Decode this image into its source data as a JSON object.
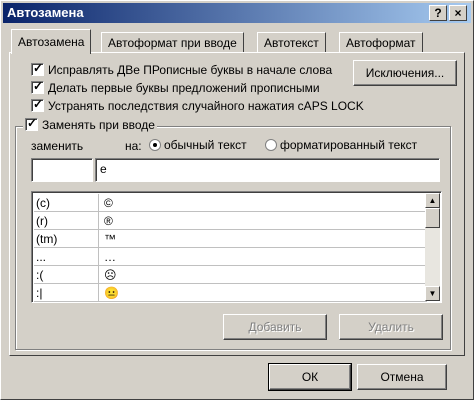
{
  "window": {
    "title": "Автозамена",
    "help_glyph": "?",
    "close_glyph": "×"
  },
  "tabs": [
    {
      "label": "Автозамена",
      "active": true
    },
    {
      "label": "Автоформат при вводе",
      "active": false
    },
    {
      "label": "Автотекст",
      "active": false
    },
    {
      "label": "Автоформат",
      "active": false
    }
  ],
  "options": [
    {
      "label": "Исправлять ДВе ПРописные буквы в начале слова",
      "checked": true
    },
    {
      "label": "Делать первые буквы предложений прописными",
      "checked": true
    },
    {
      "label": "Устранять последствия случайного нажатия cAPS LOCK",
      "checked": true
    }
  ],
  "exceptions_button": "Исключения...",
  "replace_group": {
    "label": "Заменять при вводе",
    "checked": true
  },
  "replace_label": "заменить",
  "with_label": "на:",
  "radio_plain": {
    "label": "обычный текст",
    "selected": true
  },
  "radio_formatted": {
    "label": "форматированный текст",
    "selected": false
  },
  "replace_input_value": "",
  "with_input_value": "е",
  "list": [
    {
      "from": "(c)",
      "to": "©"
    },
    {
      "from": "(r)",
      "to": "®"
    },
    {
      "from": "(tm)",
      "to": "™"
    },
    {
      "from": "...",
      "to": "…"
    },
    {
      "from": ":(",
      "to": "☹"
    },
    {
      "from": ":|",
      "to": "😐"
    }
  ],
  "scroll_up": "▲",
  "scroll_down": "▼",
  "add_button": "Добавить",
  "delete_button": "Удалить",
  "ok_button": "ОК",
  "cancel_button": "Отмена"
}
